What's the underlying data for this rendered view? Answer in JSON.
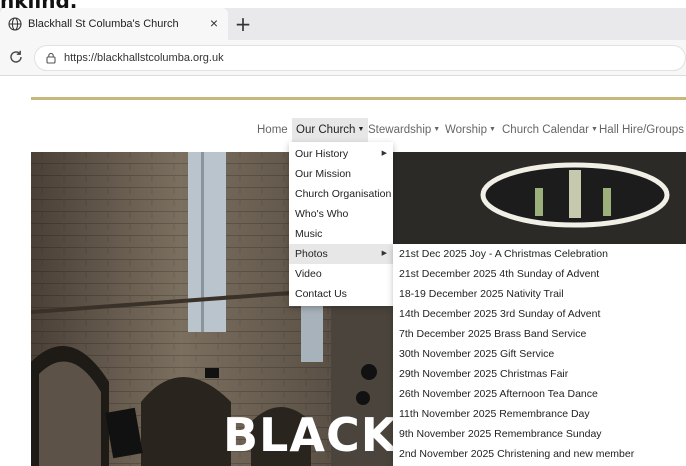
{
  "browser": {
    "tab_title": "Blackhall St Columba's Church",
    "close_glyph": "×",
    "new_tab_glyph": "+",
    "url": "https://blackhallstcolumba.org.uk"
  },
  "top_crop_text": "nkling.",
  "nav": {
    "items": [
      "Home",
      "Our Church",
      "Stewardship",
      "Worship",
      "Church Calendar",
      "Hall Hire/Groups"
    ]
  },
  "dropdown": {
    "items": [
      "Our History",
      "Our Mission",
      "Church Organisation",
      "Who's Who",
      "Music",
      "Photos",
      "Video",
      "Contact Us"
    ]
  },
  "photos_submenu": {
    "items": [
      "21st Dec 2025 Joy - A Christmas Celebration",
      "21st December 2025 4th Sunday of Advent",
      "18-19 December 2025 Nativity Trail",
      "14th December 2025 3rd Sunday of Advent",
      "7th December 2025 Brass Band Service",
      "30th November 2025 Gift Service",
      "29th November 2025 Christmas Fair",
      "26th November 2025 Afternoon Tea Dance",
      "11th November 2025 Remembrance Day",
      "9th November 2025 Remembrance Sunday",
      "2nd November 2025 Christening and new member"
    ]
  },
  "hero": {
    "title": "BLACK"
  },
  "colors": {
    "gold": "#c8b77a",
    "highlight": "#e7e7e7"
  }
}
